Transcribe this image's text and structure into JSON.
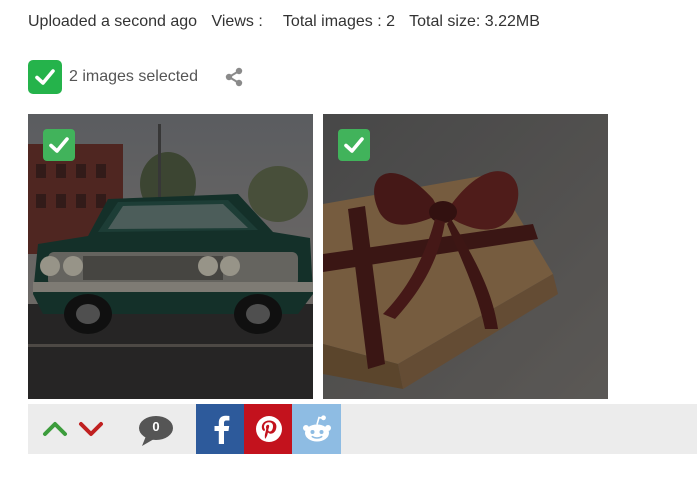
{
  "meta": {
    "uploaded": "Uploaded a second ago",
    "views": "Views :",
    "total_images": "Total images : 2",
    "total_size": "Total size: 3.22MB"
  },
  "selection": {
    "label": "2 images selected"
  },
  "images": [
    {
      "name": "classic-car-photo",
      "selected": true
    },
    {
      "name": "gift-box-photo",
      "selected": true
    }
  ],
  "actions": {
    "comment_count": "0",
    "icons": [
      "upvote-icon",
      "downvote-icon",
      "comment-icon",
      "facebook-icon",
      "pinterest-icon",
      "reddit-icon"
    ]
  },
  "colors": {
    "select_green": "#25b34b",
    "facebook": "#2d5a9b",
    "pinterest": "#c3121d",
    "reddit": "#8ebce3",
    "upvote": "#3c9c3c",
    "downvote": "#c02020"
  }
}
